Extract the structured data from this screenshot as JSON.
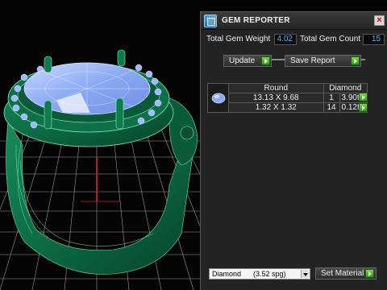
{
  "window": {
    "title": "GEM REPORTER"
  },
  "totals": {
    "weight_label": "Total Gem Weight",
    "weight_value": "4.02",
    "count_label": "Total Gem Count",
    "count_value": "15"
  },
  "actions": {
    "update_label": "Update",
    "save_label": "Save Report",
    "set_material_label": "Set Material"
  },
  "table": {
    "headers": [
      "Round",
      "Diamond"
    ],
    "rows": [
      {
        "size": "13.13 X 9.68",
        "count": "1",
        "weight": "3.90tw"
      },
      {
        "size": "1.32 X 1.32",
        "count": "14",
        "weight": "0.12tw"
      }
    ]
  },
  "material": {
    "selected": "Diamond      (3.52 spg)"
  },
  "icons": {
    "app": "gem-reporter-icon",
    "close": "close-icon",
    "go": "play-arrow-icon",
    "dropdown": "chevron-down-icon"
  },
  "colors": {
    "value_text": "#3fb6ff",
    "go_button": "#4cbc2c",
    "ring_metal": "#0f6b45",
    "gem_blue": "#8fb2ff",
    "grid_line": "#cfcfcf",
    "axis_red": "#ff2020"
  }
}
